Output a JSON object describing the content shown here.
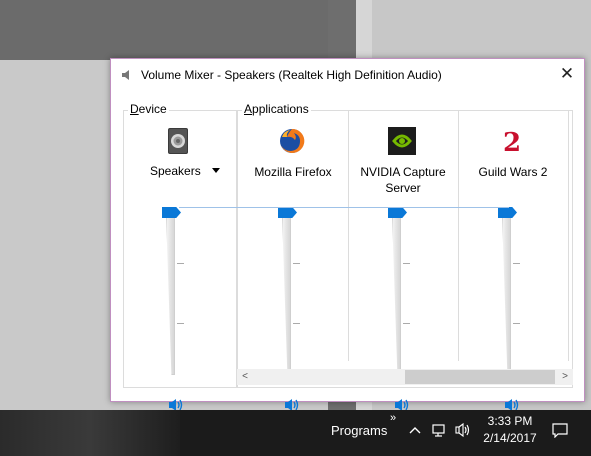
{
  "window": {
    "title": "Volume Mixer - Speakers (Realtek High Definition Audio)",
    "close_glyph": "✕"
  },
  "device_group": {
    "label_first": "D",
    "label_rest": "evice",
    "device_name": "Speakers",
    "volume_percent": 100
  },
  "applications_group": {
    "label_first": "A",
    "label_rest": "pplications",
    "apps": [
      {
        "name": "Mozilla Firefox",
        "icon": "firefox-icon",
        "volume_percent": 100
      },
      {
        "name": "NVIDIA Capture Server",
        "name_line1": "NVIDIA Capture",
        "name_line2": "Server",
        "icon": "nvidia-icon",
        "volume_percent": 100
      },
      {
        "name": "Guild Wars 2",
        "icon": "guild-wars-2-icon",
        "volume_percent": 100
      }
    ]
  },
  "scrollbar": {
    "left_arrow": "<",
    "right_arrow": ">"
  },
  "taskbar": {
    "chevron": "»",
    "toolbar_label": "Programs",
    "time": "3:33 PM",
    "date": "2/14/2017"
  },
  "colors": {
    "accent": "#0a78d7",
    "window_border": "#c08fc0",
    "taskbar": "#1b1b1b"
  }
}
